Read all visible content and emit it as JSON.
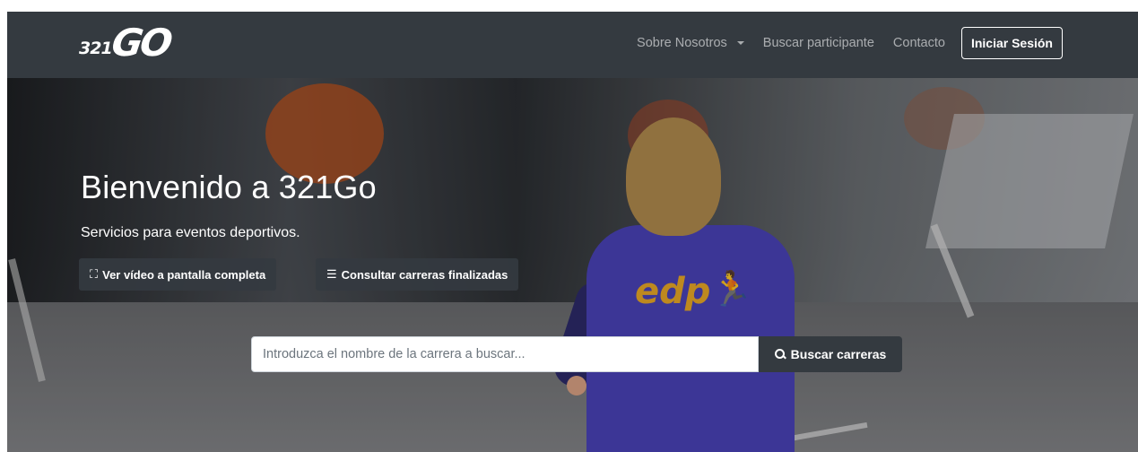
{
  "navbar": {
    "logo_numbers": "321",
    "logo_word": "GO",
    "links": {
      "about": "Sobre Nosotros",
      "search_participant": "Buscar participante",
      "contact": "Contacto"
    },
    "login": "Iniciar Sesión"
  },
  "hero": {
    "title": "Bienvenido a 321Go",
    "subtitle": "Servicios para eventos deportivos.",
    "video_button": {
      "icon": "⛶",
      "label": "Ver vídeo a pantalla completa"
    },
    "finished_button": {
      "icon": "☰",
      "label": "Consultar carreras finalizadas"
    },
    "background_shirt_text": "edp"
  },
  "search": {
    "placeholder": "Introduzca el nombre de la carrera a buscar...",
    "button_label": "Buscar carreras"
  }
}
